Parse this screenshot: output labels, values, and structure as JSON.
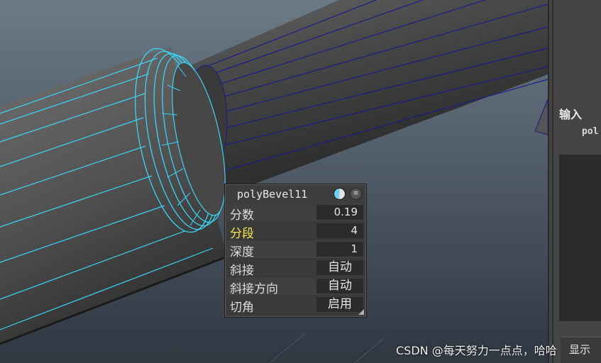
{
  "side_panel": {
    "inputs_label": "输入",
    "node_snippet": "pol",
    "display_tab": "显示"
  },
  "in_view_editor": {
    "title": "polyBevel11",
    "rows": [
      {
        "label": "分数",
        "value": "0.19",
        "highlight": false
      },
      {
        "label": "分段",
        "value": "4",
        "highlight": true
      },
      {
        "label": "深度",
        "value": "1",
        "highlight": false
      },
      {
        "label": "斜接",
        "value": "自动",
        "highlight": false
      },
      {
        "label": "斜接方向",
        "value": "自动",
        "highlight": false
      },
      {
        "label": "切角",
        "value": "启用",
        "highlight": false
      }
    ]
  },
  "watermark": "CSDN @每天努力一点点，哈哈",
  "colors": {
    "wireframe": "#39d5f5",
    "edge_lines": "#1c1c8a",
    "label_highlight": "#f5e84a"
  }
}
